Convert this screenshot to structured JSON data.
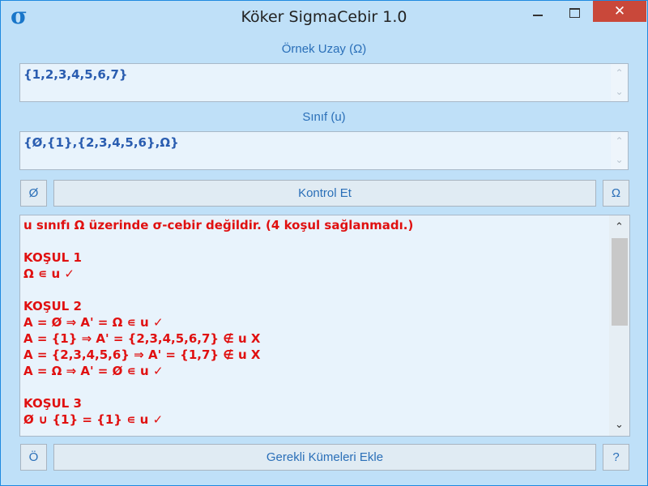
{
  "window": {
    "title": "Köker SigmaCebir 1.0",
    "icon_glyph": "σ",
    "close_glyph": "✕"
  },
  "sample_space": {
    "caption": "Örnek Uzay (Ω)",
    "value": "{1,2,3,4,5,6,7}"
  },
  "class_set": {
    "caption": "Sınıf (u)",
    "value": "{Ø,{1},{2,3,4,5,6},Ω}"
  },
  "buttons": {
    "empty_set": "Ø",
    "check": "Kontrol Et",
    "omega": "Ω",
    "o": "Ö",
    "add_required": "Gerekli Kümeleri Ekle",
    "help": "?"
  },
  "scroll": {
    "up": "⌃",
    "down": "⌄"
  },
  "output": {
    "lines": [
      "u sınıfı Ω üzerinde σ-cebir değildir. (4 koşul sağlanmadı.)",
      "",
      "KOŞUL 1",
      "Ω ∊ u ✓",
      "",
      "KOŞUL 2",
      "A = Ø ⇒ A' = Ω ∊ u ✓",
      "A = {1} ⇒ A' = {2,3,4,5,6,7} ∉ u X",
      "A = {2,3,4,5,6} ⇒ A' = {1,7} ∉ u X",
      "A = Ω ⇒ A' = Ø ∊ u ✓",
      "",
      "KOŞUL 3",
      "Ø ∪ {1} = {1} ∊ u ✓"
    ]
  },
  "colors": {
    "window_bg": "#bfe0f8",
    "accent": "#2a6fb8",
    "error_text": "#e01010",
    "close_button": "#c9483a"
  }
}
